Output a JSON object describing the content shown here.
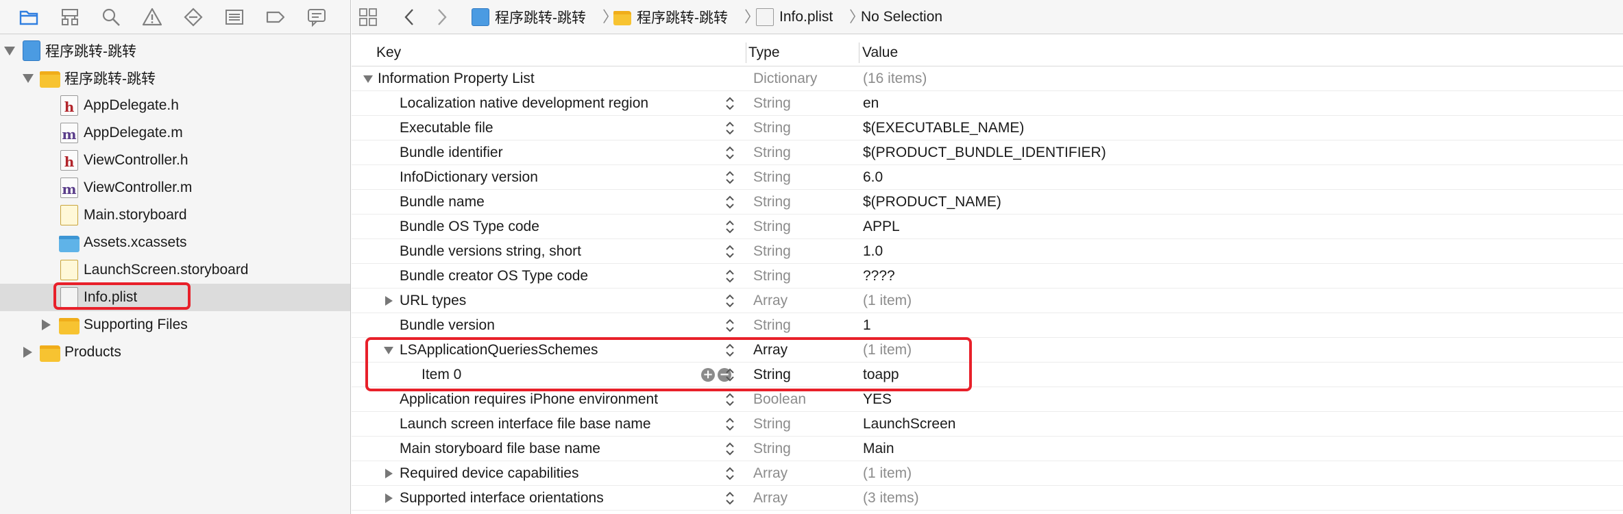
{
  "navigator": {
    "toolbar_icons": [
      "folder-icon",
      "hierarchy-icon",
      "search-icon",
      "warning-icon",
      "test-diamond-icon",
      "list-icon",
      "breakpoint-tag-icon",
      "comment-bubble-icon"
    ],
    "tree": [
      {
        "label": "程序跳转-跳转",
        "icon": "project-icon",
        "disclosure": "down",
        "level": 0
      },
      {
        "label": "程序跳转-跳转",
        "icon": "folder-icon",
        "disclosure": "down",
        "level": 1
      },
      {
        "label": "AppDelegate.h",
        "icon": "header-file-icon",
        "letter": "h",
        "level": 2
      },
      {
        "label": "AppDelegate.m",
        "icon": "source-file-icon",
        "letter": "m",
        "level": 2
      },
      {
        "label": "ViewController.h",
        "icon": "header-file-icon",
        "letter": "h",
        "level": 2
      },
      {
        "label": "ViewController.m",
        "icon": "source-file-icon",
        "letter": "m",
        "level": 2
      },
      {
        "label": "Main.storyboard",
        "icon": "storyboard-icon",
        "level": 2
      },
      {
        "label": "Assets.xcassets",
        "icon": "asset-catalog-icon",
        "level": 2
      },
      {
        "label": "LaunchScreen.storyboard",
        "icon": "storyboard-icon",
        "level": 2
      },
      {
        "label": "Info.plist",
        "icon": "plist-file-icon",
        "level": 2,
        "selected": true
      },
      {
        "label": "Supporting Files",
        "icon": "folder-icon",
        "disclosure": "right",
        "level": 2
      },
      {
        "label": "Products",
        "icon": "folder-icon",
        "disclosure": "right",
        "level": 1
      }
    ]
  },
  "jump_bar": {
    "crumbs": [
      "程序跳转-跳转",
      "程序跳转-跳转",
      "Info.plist",
      "No Selection"
    ]
  },
  "plist": {
    "headers": {
      "key": "Key",
      "type": "Type",
      "value": "Value"
    },
    "rows": [
      {
        "key": "Information Property List",
        "type": "Dictionary",
        "value": "(16 items)",
        "level": 0,
        "disclosure": "down",
        "muted": true
      },
      {
        "key": "Localization native development region",
        "type": "String",
        "value": "en",
        "level": 1
      },
      {
        "key": "Executable file",
        "type": "String",
        "value": "$(EXECUTABLE_NAME)",
        "level": 1
      },
      {
        "key": "Bundle identifier",
        "type": "String",
        "value": "$(PRODUCT_BUNDLE_IDENTIFIER)",
        "level": 1
      },
      {
        "key": "InfoDictionary version",
        "type": "String",
        "value": "6.0",
        "level": 1
      },
      {
        "key": "Bundle name",
        "type": "String",
        "value": "$(PRODUCT_NAME)",
        "level": 1
      },
      {
        "key": "Bundle OS Type code",
        "type": "String",
        "value": "APPL",
        "level": 1
      },
      {
        "key": "Bundle versions string, short",
        "type": "String",
        "value": "1.0",
        "level": 1
      },
      {
        "key": "Bundle creator OS Type code",
        "type": "String",
        "value": "????",
        "level": 1
      },
      {
        "key": "URL types",
        "type": "Array",
        "value": "(1 item)",
        "level": 1,
        "disclosure": "right",
        "muted": true
      },
      {
        "key": "Bundle version",
        "type": "String",
        "value": "1",
        "level": 1
      },
      {
        "key": "LSApplicationQueriesSchemes",
        "type": "Array",
        "value": "(1 item)",
        "level": 1,
        "disclosure": "down",
        "muted": true,
        "dark_type": true
      },
      {
        "key": "Item 0",
        "type": "String",
        "value": "toapp",
        "level": 2,
        "dark_type": true,
        "editing": true
      },
      {
        "key": "Application requires iPhone environment",
        "type": "Boolean",
        "value": "YES",
        "level": 1
      },
      {
        "key": "Launch screen interface file base name",
        "type": "String",
        "value": "LaunchScreen",
        "level": 1
      },
      {
        "key": "Main storyboard file base name",
        "type": "String",
        "value": "Main",
        "level": 1
      },
      {
        "key": "Required device capabilities",
        "type": "Array",
        "value": "(1 item)",
        "level": 1,
        "disclosure": "right",
        "muted": true
      },
      {
        "key": "Supported interface orientations",
        "type": "Array",
        "value": "(3 items)",
        "level": 1,
        "disclosure": "right",
        "muted": true
      }
    ]
  },
  "colors": {
    "highlight": "#e8202a",
    "accent": "#2f7ee0",
    "muted_text": "#8c8c8c"
  }
}
